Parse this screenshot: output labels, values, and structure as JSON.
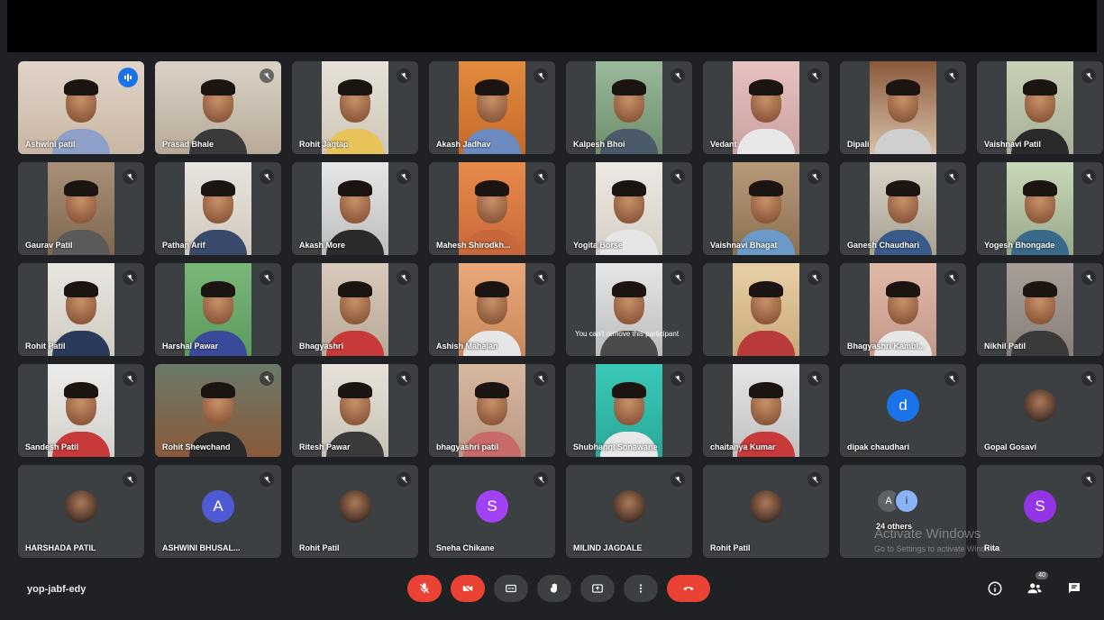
{
  "meeting": {
    "code": "yop-jabf-edy",
    "others_count_label": "24 others",
    "tooltip": "You can't remove this participant",
    "watermark": {
      "title": "Activate Windows",
      "subtitle": "Go to Settings to activate Windows."
    }
  },
  "colors": {
    "background": "#202124",
    "tile": "#3c4043",
    "accent_blue": "#1a73e8",
    "danger_red": "#ea4335"
  },
  "participants": [
    {
      "name": "Ashwini patil",
      "type": "video",
      "speaking": true
    },
    {
      "name": "Prasad Bhale",
      "type": "video"
    },
    {
      "name": "Rohit Jagtap",
      "type": "video"
    },
    {
      "name": "Akash Jadhav",
      "type": "video"
    },
    {
      "name": "Kalpesh Bhoi",
      "type": "video"
    },
    {
      "name": "Vedant",
      "type": "video"
    },
    {
      "name": "Dipali",
      "type": "video"
    },
    {
      "name": "Vaishnavi Patil",
      "type": "video"
    },
    {
      "name": "Gaurav Patil",
      "type": "video"
    },
    {
      "name": "Pathan Arif",
      "type": "video"
    },
    {
      "name": "Akash More",
      "type": "video"
    },
    {
      "name": "Mahesh Shirodkh...",
      "type": "video"
    },
    {
      "name": "Yogita Borse",
      "type": "video"
    },
    {
      "name": "Vaishnavi Bhagat",
      "type": "video"
    },
    {
      "name": "Ganesh Chaudhari",
      "type": "video"
    },
    {
      "name": "Yogesh Bhongade",
      "type": "video"
    },
    {
      "name": "Rohit Patil",
      "type": "video"
    },
    {
      "name": "Harshal Pawar",
      "type": "video"
    },
    {
      "name": "Bhagyashri",
      "type": "video"
    },
    {
      "name": "Ashish Mahajan",
      "type": "video"
    },
    {
      "name": "",
      "type": "video"
    },
    {
      "name": "",
      "type": "video"
    },
    {
      "name": "Bhagyashri Kambl...",
      "type": "video"
    },
    {
      "name": "Nikhil Patil",
      "type": "video"
    },
    {
      "name": "Sandesh Patil",
      "type": "video"
    },
    {
      "name": "Rohit Shewchand",
      "type": "video"
    },
    {
      "name": "Ritesh Pawar",
      "type": "video"
    },
    {
      "name": "bhagyashri patil",
      "type": "video"
    },
    {
      "name": "Shubhangi Sonawane",
      "type": "video"
    },
    {
      "name": "chaitanya Kumar",
      "type": "video"
    },
    {
      "name": "dipak chaudhari",
      "type": "avatar",
      "initial": "d",
      "color": "#1a73e8"
    },
    {
      "name": "Gopal Gosavi",
      "type": "avatar-photo"
    },
    {
      "name": "HARSHADA PATIL",
      "type": "avatar-photo"
    },
    {
      "name": "ASHWINI BHUSAL...",
      "type": "avatar",
      "initial": "A",
      "color": "#4f5bd5"
    },
    {
      "name": "Rohit Patil",
      "type": "avatar-photo"
    },
    {
      "name": "Sneha Chikane",
      "type": "avatar",
      "initial": "S",
      "color": "#a142f4"
    },
    {
      "name": "MILIND JAGDALE",
      "type": "avatar-photo"
    },
    {
      "name": "Rohit Patil",
      "type": "avatar-photo"
    },
    {
      "name": "",
      "type": "others"
    },
    {
      "name": "Rita",
      "type": "avatar",
      "initial": "S",
      "color": "#9334e6"
    }
  ],
  "toolbar": {
    "buttons": [
      "mic-off",
      "camera-off",
      "captions",
      "raise-hand",
      "present",
      "more-options",
      "leave-call"
    ],
    "right": [
      "info",
      "people",
      "chat"
    ],
    "people_badge": "40"
  }
}
